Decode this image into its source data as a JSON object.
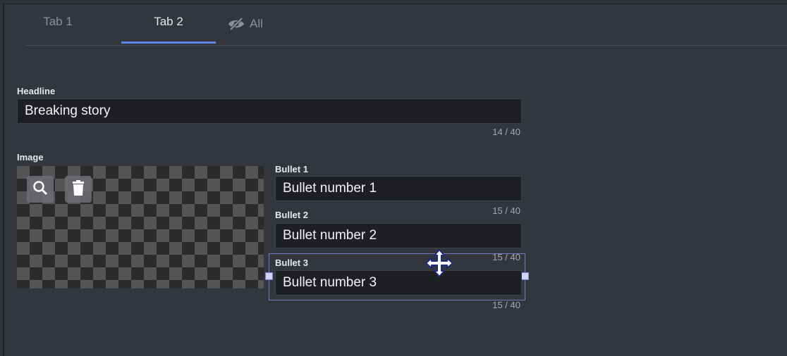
{
  "tabs": [
    {
      "label": "Tab 1"
    },
    {
      "label": "Tab 2",
      "active": true
    },
    {
      "label": "All",
      "icon": "eye-off-icon"
    }
  ],
  "headline": {
    "label": "Headline",
    "value": "Breaking story",
    "counter": "14 / 40"
  },
  "image": {
    "label": "Image",
    "buttons": [
      "search-icon",
      "trash-icon"
    ]
  },
  "bullets": [
    {
      "label": "Bullet 1",
      "value": "Bullet number 1",
      "counter": "15 / 40"
    },
    {
      "label": "Bullet 2",
      "value": "Bullet number 2",
      "counter": "15 / 40"
    },
    {
      "label": "Bullet 3",
      "value": "Bullet number 3",
      "counter": "15 / 40"
    }
  ],
  "colors": {
    "accent": "#5d86e6",
    "selection": "#6f77c7",
    "background": "#33363d",
    "field": "#1d1f23"
  }
}
